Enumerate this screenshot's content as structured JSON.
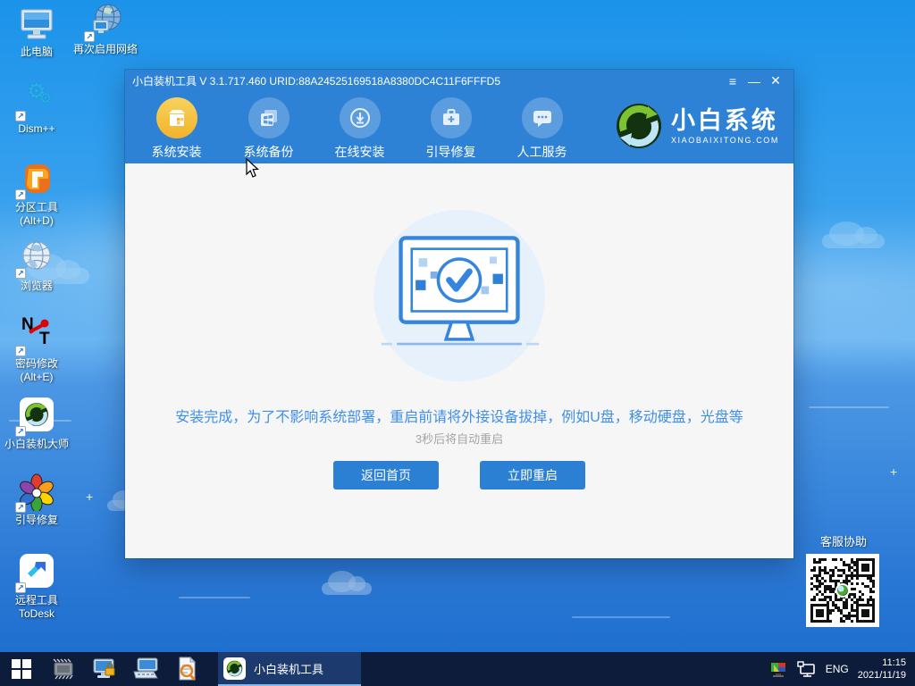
{
  "desktop": {
    "icons": [
      {
        "label": "此电脑"
      },
      {
        "label": "再次启用网络"
      },
      {
        "label": "Dism++"
      },
      {
        "label": "分区工具",
        "label2": "(Alt+D)"
      },
      {
        "label": "浏览器"
      },
      {
        "label": "密码修改",
        "label2": "(Alt+E)"
      },
      {
        "label": "小白装机大师"
      },
      {
        "label": "引导修复"
      },
      {
        "label": "远程工具",
        "label2": "ToDesk"
      }
    ]
  },
  "window": {
    "title": "小白装机工具 V 3.1.717.460 URID:88A24525169518A8380DC4C11F6FFFD5",
    "controls": {
      "menu": "≡",
      "minimize": "—",
      "close": "✕"
    },
    "nav": {
      "items": [
        {
          "label": "系统安装"
        },
        {
          "label": "系统备份"
        },
        {
          "label": "在线安装"
        },
        {
          "label": "引导修复"
        },
        {
          "label": "人工服务"
        }
      ]
    },
    "brand": {
      "name": "小白系统",
      "domain": "XIAOBAIXITONG.COM"
    },
    "content": {
      "message": "安装完成，为了不影响系统部署，重启前请将外接设备拔掉，例如U盘，移动硬盘，光盘等",
      "countdown": "3秒后将自动重启",
      "back_button": "返回首页",
      "restart_button": "立即重启"
    }
  },
  "support": {
    "title": "客服协助"
  },
  "taskbar": {
    "active_app": "小白装机工具",
    "language": "ENG",
    "time": "11:15",
    "date": "2021/11/19"
  },
  "colors": {
    "header_blue": "#2e82d6",
    "accent_button": "#2b80d4",
    "message_blue": "#3f8fe8",
    "active_tab_yellow": "#f2b32b",
    "taskbar_navy": "#0e1c3c"
  }
}
